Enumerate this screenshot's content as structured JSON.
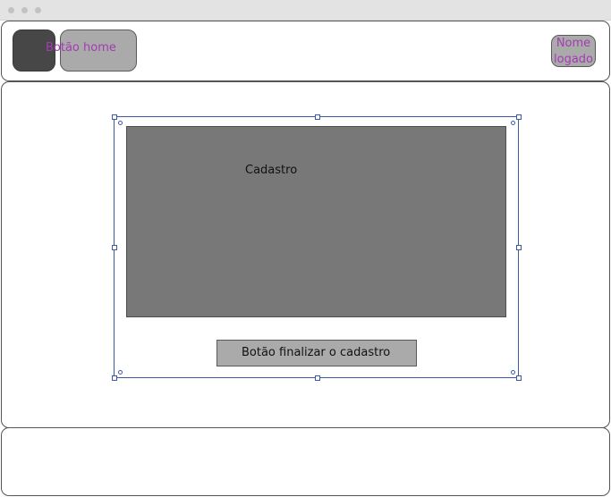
{
  "header": {
    "home_button_label": "Botão home",
    "user_name_label": "Nome logado"
  },
  "form": {
    "title": "Cadastro",
    "finish_button_label": "Botão finalizar o cadastro"
  },
  "colors": {
    "accent_text": "#a43bb4",
    "selection_outline": "#3a5aa8",
    "form_fill": "#787878",
    "button_fill": "#aaaaaa",
    "logo_fill": "#474747"
  }
}
